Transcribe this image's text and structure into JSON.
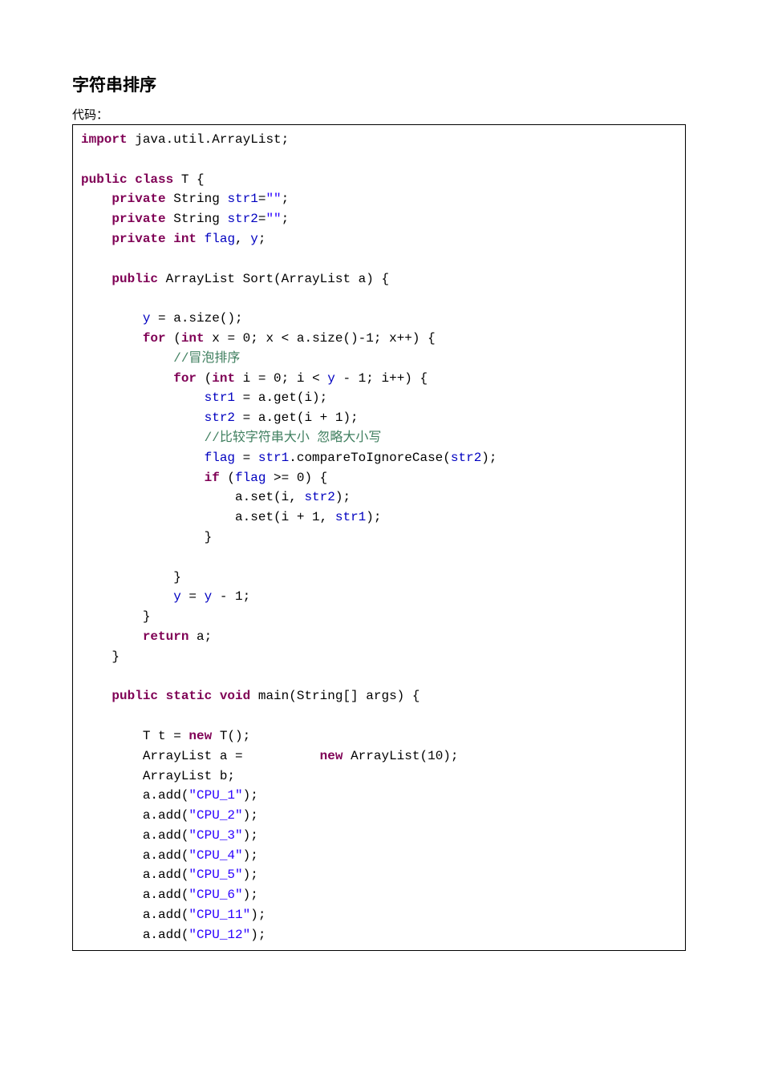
{
  "title": "字符串排序",
  "code_label": "代码：",
  "code": {
    "l1": {
      "kw1": "import",
      "t1": " java.util.ArrayList;"
    },
    "l2": "",
    "l3": {
      "kw1": "public class",
      "t1": " T {"
    },
    "l4": {
      "kw1": "private",
      "t1": " String ",
      "fld": "str1",
      "t2": "=",
      "str": "\"\"",
      "t3": ";"
    },
    "l5": {
      "kw1": "private",
      "t1": " String ",
      "fld": "str2",
      "t2": "=",
      "str": "\"\"",
      "t3": ";"
    },
    "l6": {
      "kw1": "private int",
      "t1": " ",
      "fld1": "flag",
      "t2": ", ",
      "fld2": "y",
      "t3": ";"
    },
    "l7": "",
    "l8": {
      "kw1": "public",
      "t1": " ArrayList Sort(ArrayList a) {"
    },
    "l9": "",
    "l10": {
      "fld": "y",
      "t1": " = a.size();"
    },
    "l11": {
      "kw1": "for",
      "t1": " (",
      "kw2": "int",
      "t2": " x = 0; x < a.size()-1; x++) {"
    },
    "l12": {
      "cmt": "//冒泡排序"
    },
    "l13": {
      "kw1": "for",
      "t1": " (",
      "kw2": "int",
      "t2": " i = 0; i < ",
      "fld": "y",
      "t3": " - 1; i++) {"
    },
    "l14": {
      "fld": "str1",
      "t1": " = a.get(i);"
    },
    "l15": {
      "fld": "str2",
      "t1": " = a.get(i + 1);"
    },
    "l16": {
      "cmt": "//比较字符串大小 忽略大小写"
    },
    "l17": {
      "fld1": "flag",
      "t1": " = ",
      "fld2": "str1",
      "t2": ".compareToIgnoreCase(",
      "fld3": "str2",
      "t3": ");"
    },
    "l18": {
      "kw1": "if",
      "t1": " (",
      "fld": "flag",
      "t2": " >= 0) {"
    },
    "l19": {
      "t1": "a.set(i, ",
      "fld": "str2",
      "t2": ");"
    },
    "l20": {
      "t1": "a.set(i + 1, ",
      "fld": "str1",
      "t2": ");"
    },
    "l21": "}",
    "l22": "",
    "l23": "}",
    "l24": {
      "fld": "y",
      "t1": " = ",
      "fld2": "y",
      "t2": " - 1;"
    },
    "l25": "}",
    "l26": {
      "kw1": "return",
      "t1": " a;"
    },
    "l27": "}",
    "l28": "",
    "l29": {
      "kw1": "public static void",
      "t1": " main(String[] args) {"
    },
    "l30": "",
    "l31": {
      "t1": "T t = ",
      "kw1": "new",
      "t2": " T();"
    },
    "l32": {
      "t1": "ArrayList a =          ",
      "kw1": "new",
      "t2": " ArrayList(10);"
    },
    "l33": "ArrayList b;",
    "l34": {
      "t1": "a.add(",
      "str": "\"CPU_1\"",
      "t2": ");"
    },
    "l35": {
      "t1": "a.add(",
      "str": "\"CPU_2\"",
      "t2": ");"
    },
    "l36": {
      "t1": "a.add(",
      "str": "\"CPU_3\"",
      "t2": ");"
    },
    "l37": {
      "t1": "a.add(",
      "str": "\"CPU_4\"",
      "t2": ");"
    },
    "l38": {
      "t1": "a.add(",
      "str": "\"CPU_5\"",
      "t2": ");"
    },
    "l39": {
      "t1": "a.add(",
      "str": "\"CPU_6\"",
      "t2": ");"
    },
    "l40": {
      "t1": "a.add(",
      "str": "\"CPU_11\"",
      "t2": ");"
    },
    "l41": {
      "t1": "a.add(",
      "str": "\"CPU_12\"",
      "t2": ");"
    }
  }
}
